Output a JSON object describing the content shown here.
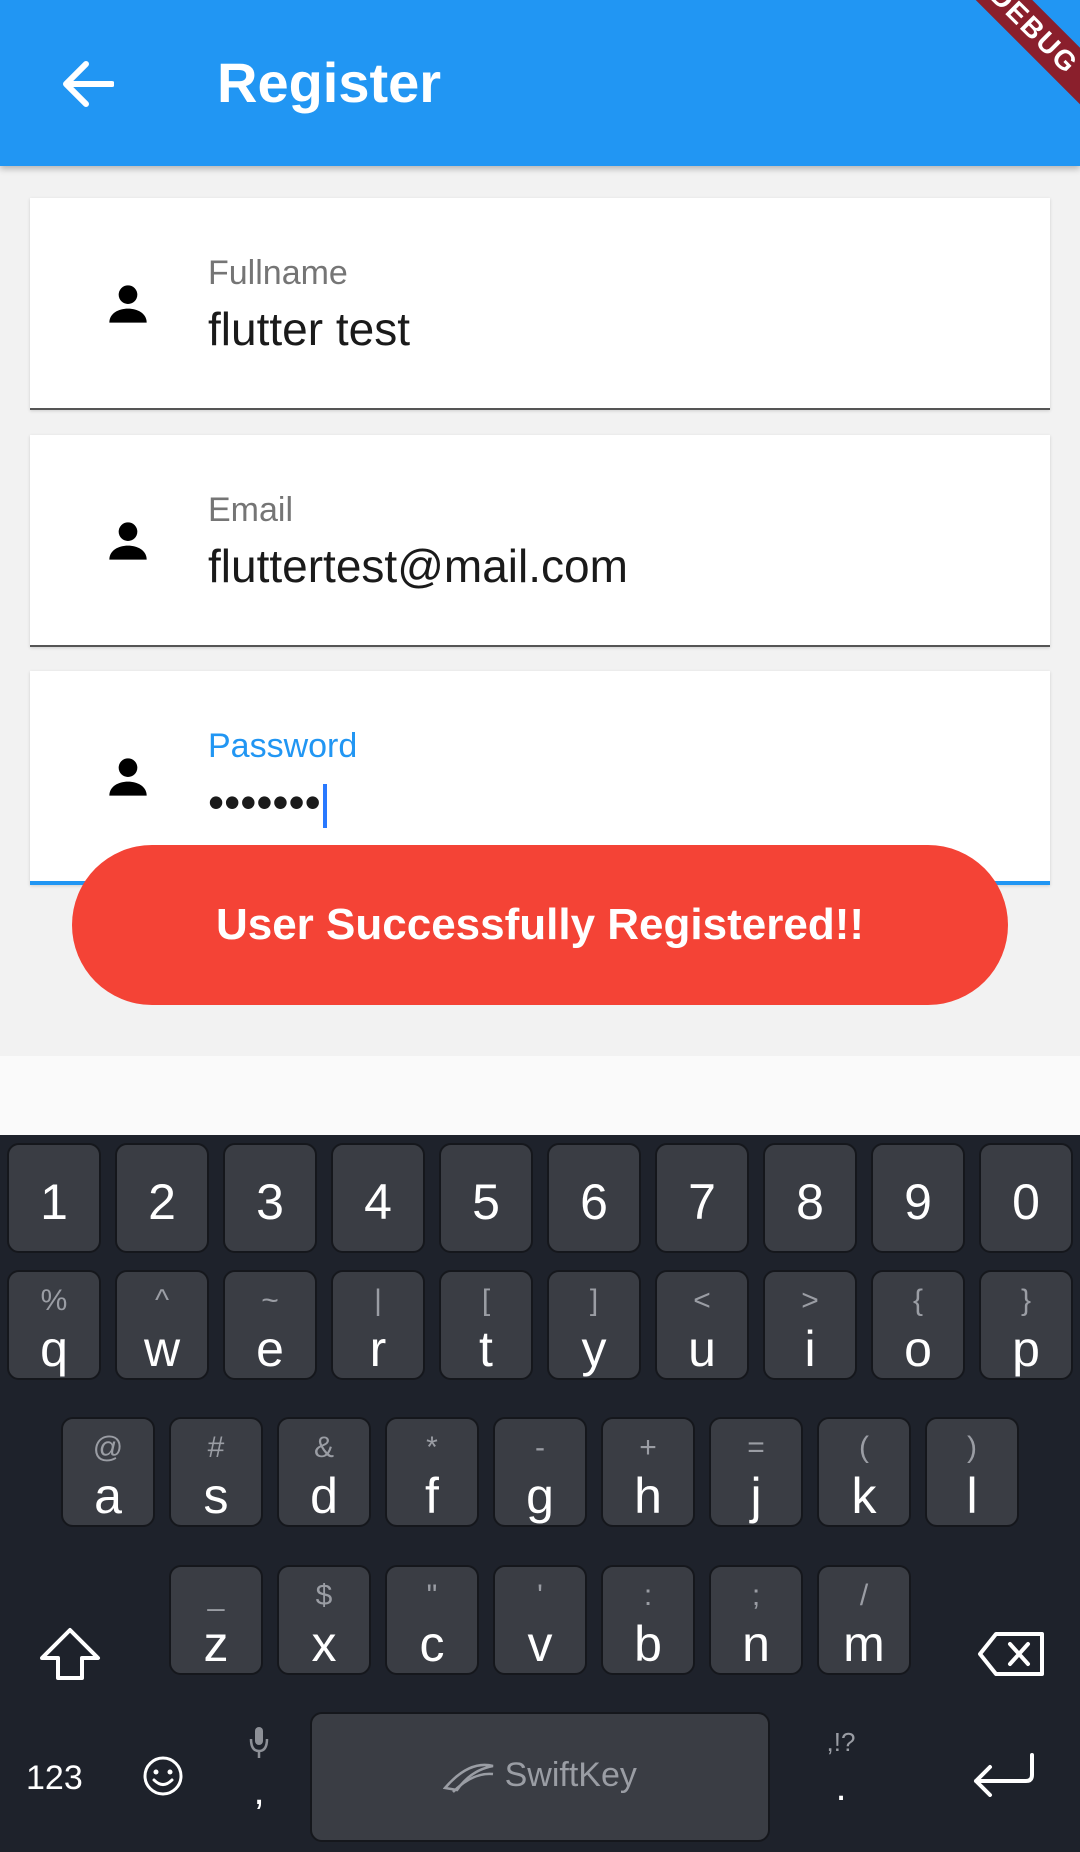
{
  "appbar": {
    "title": "Register",
    "debug_banner": "DEBUG"
  },
  "form": {
    "fullname": {
      "label": "Fullname",
      "value": "flutter test"
    },
    "email": {
      "label": "Email",
      "value": "fluttertest@mail.com"
    },
    "password": {
      "label": "Password",
      "value": "•••••••"
    }
  },
  "toast": {
    "message": "User Successfully Registered!!"
  },
  "keyboard": {
    "number_row": [
      "1",
      "2",
      "3",
      "4",
      "5",
      "6",
      "7",
      "8",
      "9",
      "0"
    ],
    "row1": [
      {
        "key": "q",
        "sub": "%"
      },
      {
        "key": "w",
        "sub": "^"
      },
      {
        "key": "e",
        "sub": "~"
      },
      {
        "key": "r",
        "sub": "|"
      },
      {
        "key": "t",
        "sub": "["
      },
      {
        "key": "y",
        "sub": "]"
      },
      {
        "key": "u",
        "sub": "<"
      },
      {
        "key": "i",
        "sub": ">"
      },
      {
        "key": "o",
        "sub": "{"
      },
      {
        "key": "p",
        "sub": "}"
      }
    ],
    "row2": [
      {
        "key": "a",
        "sub": "@"
      },
      {
        "key": "s",
        "sub": "#"
      },
      {
        "key": "d",
        "sub": "&"
      },
      {
        "key": "f",
        "sub": "*"
      },
      {
        "key": "g",
        "sub": "-"
      },
      {
        "key": "h",
        "sub": "+"
      },
      {
        "key": "j",
        "sub": "="
      },
      {
        "key": "k",
        "sub": "("
      },
      {
        "key": "l",
        "sub": ")"
      }
    ],
    "row3": [
      {
        "key": "z",
        "sub": "_"
      },
      {
        "key": "x",
        "sub": "$"
      },
      {
        "key": "c",
        "sub": "\""
      },
      {
        "key": "v",
        "sub": "'"
      },
      {
        "key": "b",
        "sub": ":"
      },
      {
        "key": "n",
        "sub": ";"
      },
      {
        "key": "m",
        "sub": "/"
      }
    ],
    "numbers_toggle": "123",
    "comma": ",",
    "space_brand": "SwiftKey",
    "period": ".",
    "punct_hint": ",!?"
  },
  "colors": {
    "appbar": "#2196f3",
    "toast": "#f44336",
    "keyboard": "#1e222b"
  }
}
